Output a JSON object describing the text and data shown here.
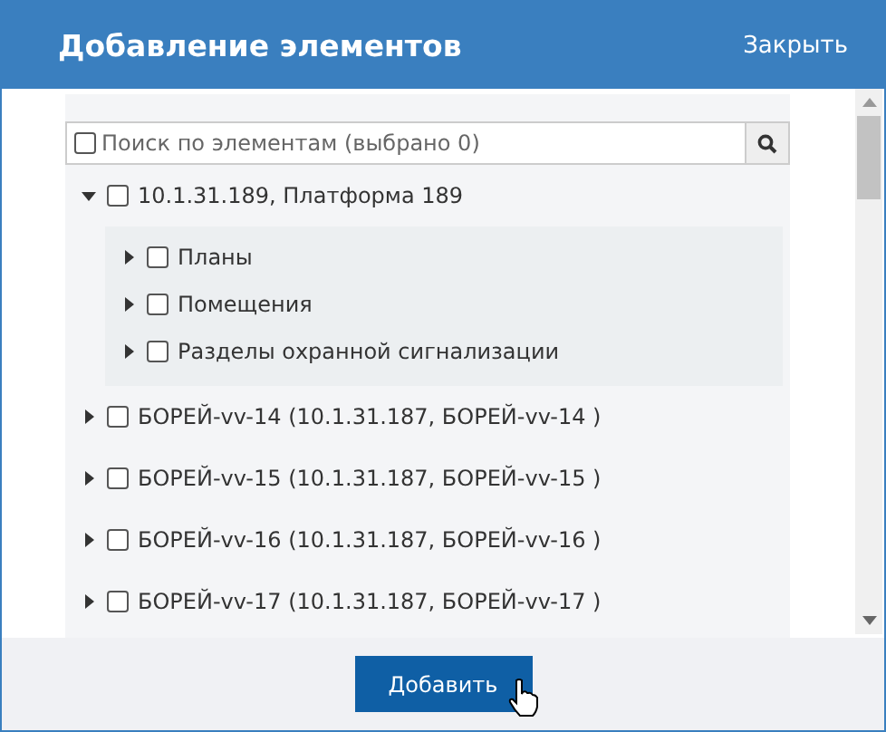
{
  "dialog": {
    "title": "Добавление элементов",
    "close": "Закрыть"
  },
  "search": {
    "placeholder": "Поиск по элементам (выбрано 0)",
    "select_all_checked": false
  },
  "tree": [
    {
      "label": "10.1.31.189, Платформа 189",
      "expanded": true,
      "checked": false,
      "children": [
        {
          "label": "Планы",
          "expanded": false,
          "checked": false
        },
        {
          "label": "Помещения",
          "expanded": false,
          "checked": false
        },
        {
          "label": "Разделы охранной сигнализации",
          "expanded": false,
          "checked": false
        }
      ]
    },
    {
      "label": "БОРЕЙ-vv-14 (10.1.31.187, БОРЕЙ-vv-14 )",
      "expanded": false,
      "checked": false
    },
    {
      "label": "БОРЕЙ-vv-15 (10.1.31.187, БОРЕЙ-vv-15 )",
      "expanded": false,
      "checked": false
    },
    {
      "label": "БОРЕЙ-vv-16 (10.1.31.187, БОРЕЙ-vv-16 )",
      "expanded": false,
      "checked": false
    },
    {
      "label": "БОРЕЙ-vv-17 (10.1.31.187, БОРЕЙ-vv-17 )",
      "expanded": false,
      "checked": false
    }
  ],
  "add_button": "Добавить"
}
